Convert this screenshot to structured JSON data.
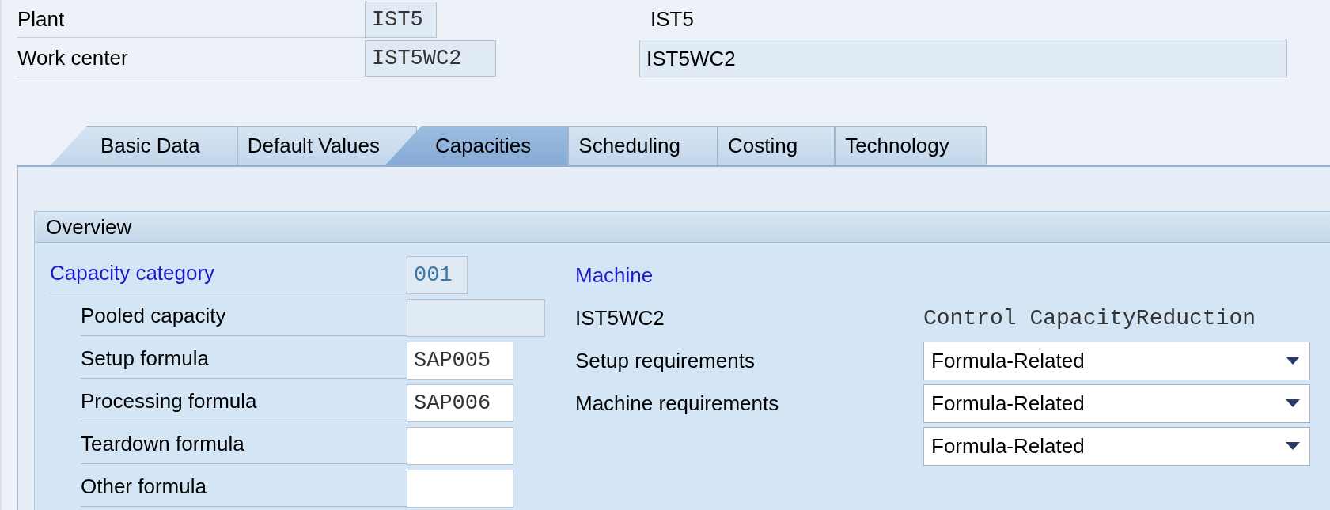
{
  "header": [
    {
      "label": "Plant",
      "value": "IST5",
      "description": {
        "kind": "text",
        "value": "IST5"
      }
    },
    {
      "label": "Work center",
      "value": "IST5WC2",
      "description": {
        "kind": "field",
        "value": "IST5WC2"
      }
    }
  ],
  "tabs": [
    {
      "label": "Basic Data",
      "selected": false
    },
    {
      "label": "Default Values",
      "selected": false
    },
    {
      "label": "Capacities",
      "selected": true
    },
    {
      "label": "Scheduling",
      "selected": false
    },
    {
      "label": "Costing",
      "selected": false
    },
    {
      "label": "Technology",
      "selected": false
    }
  ],
  "overview": {
    "title": "Overview",
    "capacity_category": {
      "label": "Capacity category",
      "value": "001"
    },
    "fields": [
      {
        "label": "Pooled capacity",
        "kind": "readonly"
      },
      {
        "label": "Setup formula",
        "value": "SAP005",
        "kind": "input"
      },
      {
        "label": "Processing formula",
        "value": "SAP006",
        "kind": "input"
      },
      {
        "label": "Teardown formula",
        "kind": "input"
      },
      {
        "label": "Other formula",
        "kind": "input"
      }
    ],
    "machine": {
      "title": "Machine",
      "name": "IST5WC2",
      "column_header": "Control CapacityReduction",
      "rows": [
        {
          "label": "Setup requirements",
          "value": "Formula-Related"
        },
        {
          "label": "Machine requirements",
          "value": "Formula-Related"
        },
        {
          "value": "Formula-Related"
        }
      ]
    }
  }
}
